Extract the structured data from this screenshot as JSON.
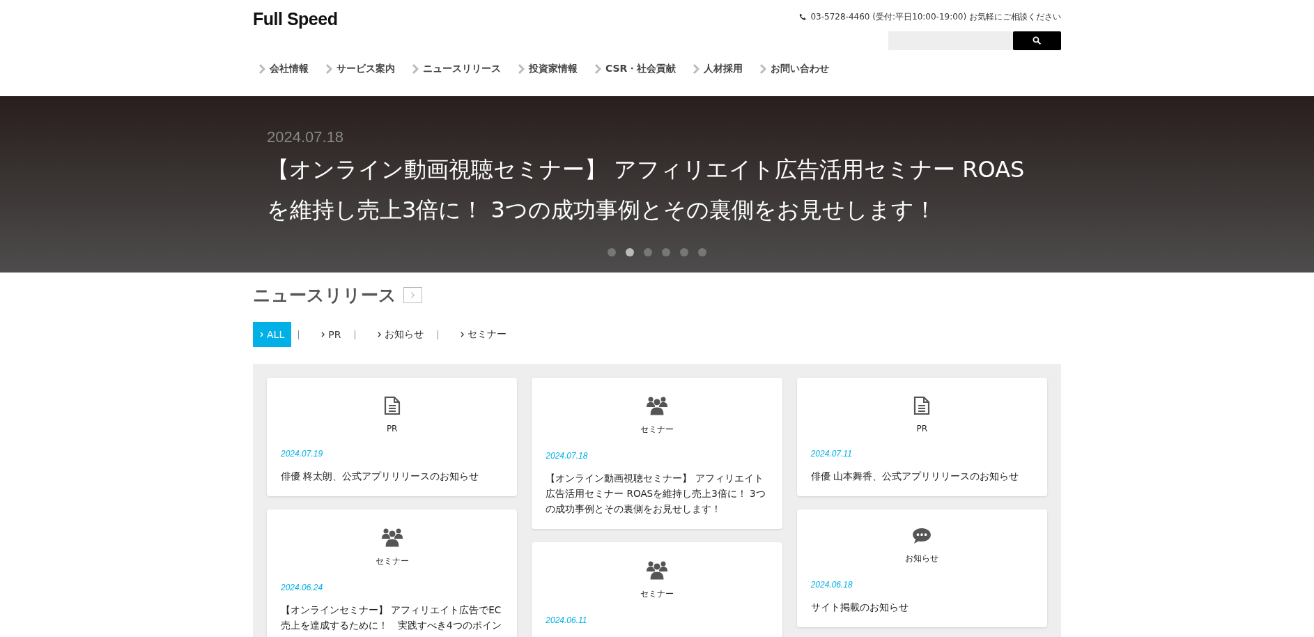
{
  "header": {
    "logo": "Full Speed",
    "contact": "03-5728-4460 (受付:平日10:00-19:00) お気軽にご相談ください"
  },
  "nav": [
    "会社情報",
    "サービス案内",
    "ニュースリリース",
    "投資家情報",
    "CSR・社会貢献",
    "人材採用",
    "お問い合わせ"
  ],
  "hero": {
    "date": "2024.07.18",
    "title": "【オンライン動画視聴セミナー】 アフィリエイト広告活用セミナー ROAS を維持し売上3倍に！ 3つの成功事例とその裏側をお見せします！",
    "dots": [
      {
        "selected": false
      },
      {
        "selected": true
      },
      {
        "selected": false
      },
      {
        "selected": false
      },
      {
        "selected": false
      },
      {
        "selected": false
      }
    ]
  },
  "news": {
    "title": "ニュースリリース",
    "filters": [
      {
        "label": "ALL",
        "selected": true
      },
      {
        "label": "PR",
        "selected": false
      },
      {
        "label": "お知らせ",
        "selected": false
      },
      {
        "label": "セミナー",
        "selected": false
      }
    ],
    "columns": [
      [
        {
          "kind": "document",
          "category": "PR",
          "date": "2024.07.19",
          "title": "俳優 柊太朗、公式アプリリリースのお知らせ"
        },
        {
          "kind": "people",
          "category": "セミナー",
          "date": "2024.06.24",
          "title": "【オンラインセミナー】 アフィリエイト広告でEC売上を達成するために！　実践すべき4つのポイン"
        }
      ],
      [
        {
          "kind": "people",
          "category": "セミナー",
          "date": "2024.07.18",
          "title": "【オンライン動画視聴セミナー】 アフィリエイト広告活用セミナー ROASを維持し売上3倍に！ 3つの成功事例とその裏側をお見せします！"
        },
        {
          "kind": "people",
          "category": "セミナー",
          "date": "2024.06.11"
        }
      ],
      [
        {
          "kind": "document",
          "category": "PR",
          "date": "2024.07.11",
          "title": "俳優 山本舞香、公式アプリリリースのお知らせ"
        },
        {
          "kind": "chat",
          "category": "お知らせ",
          "date": "2024.06.18",
          "title": "サイト掲載のお知らせ"
        }
      ]
    ]
  }
}
